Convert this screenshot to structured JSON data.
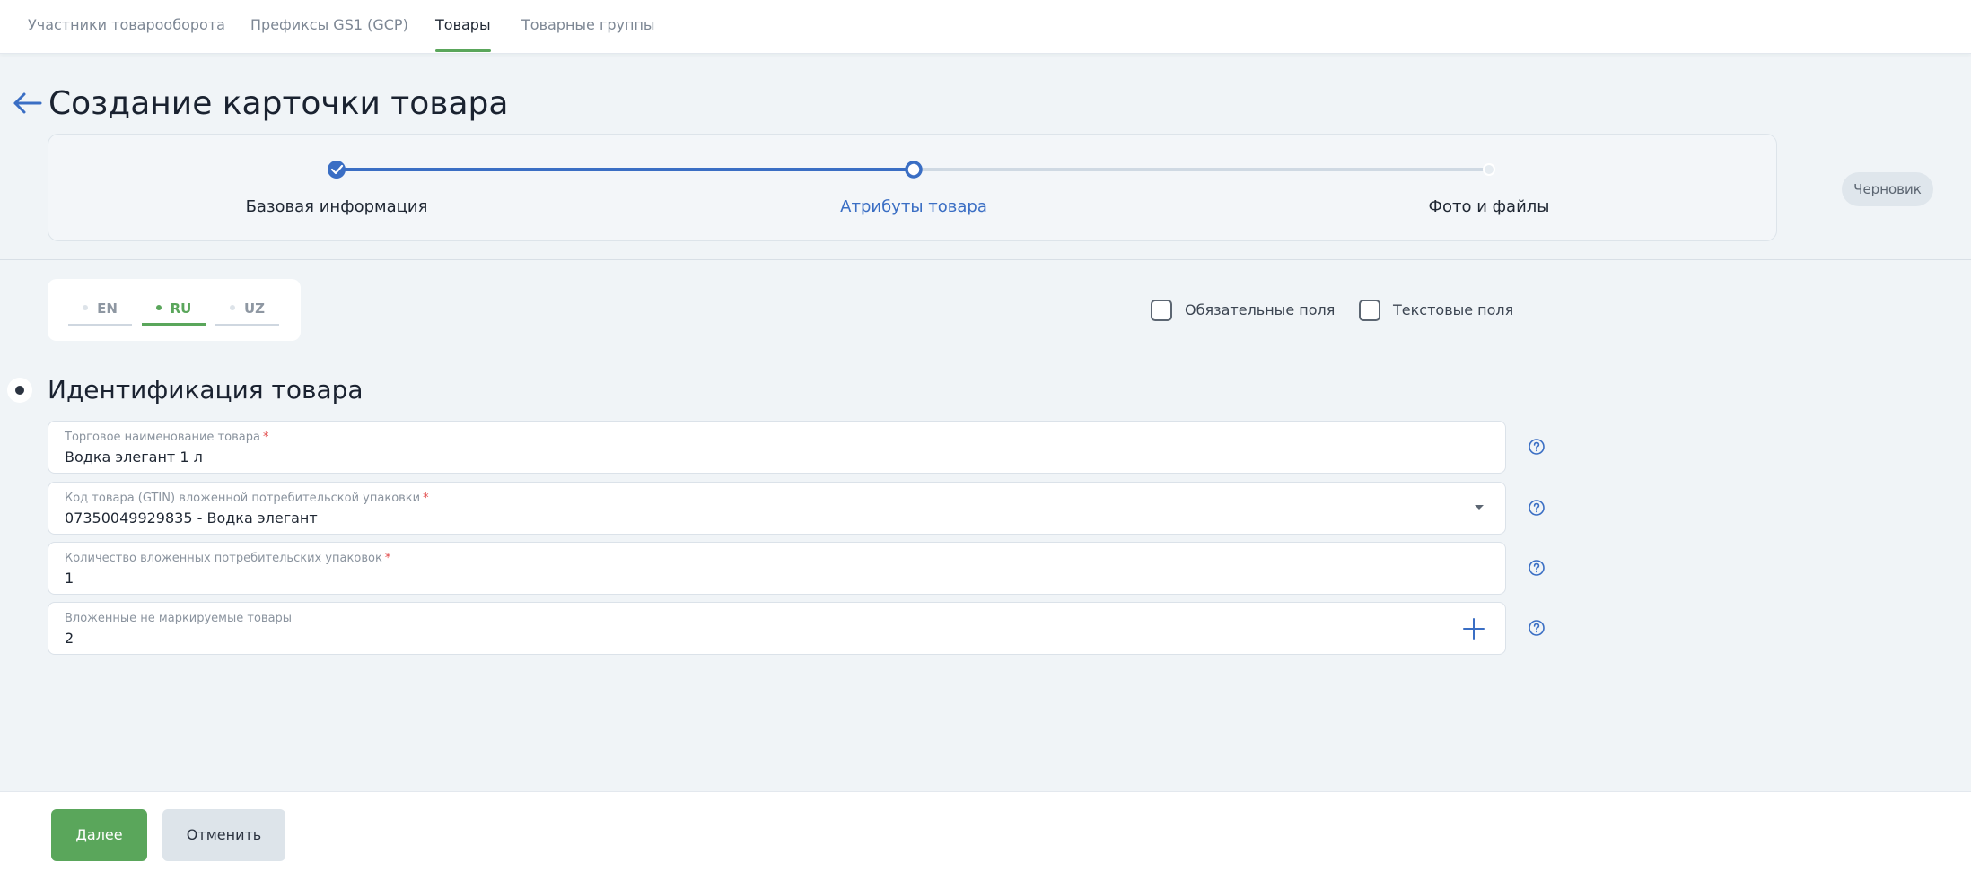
{
  "nav": {
    "tabs": [
      {
        "label": "Участники товарооборота"
      },
      {
        "label": "Префиксы GS1 (GCP)"
      },
      {
        "label": "Товары"
      },
      {
        "label": "Товарные группы"
      }
    ],
    "active_tab": "Товары"
  },
  "page": {
    "title": "Создание карточки товара",
    "status_badge": "Черновик"
  },
  "stepper": {
    "steps": [
      {
        "label": "Базовая информация",
        "state": "done"
      },
      {
        "label": "Атрибуты товара",
        "state": "current"
      },
      {
        "label": "Фото и файлы",
        "state": "pending"
      }
    ]
  },
  "languages": {
    "items": [
      "EN",
      "RU",
      "UZ"
    ],
    "active": "RU"
  },
  "filters": {
    "required_label": "Обязательные поля",
    "required_checked": false,
    "text_label": "Текстовые поля",
    "text_checked": false
  },
  "section": {
    "title": "Идентификация товара",
    "fields": [
      {
        "label": "Торговое наименование товара",
        "required": "*",
        "value": "Водка элегант 1 л"
      },
      {
        "label": "Код товара (GTIN) вложенной потребительской упаковки",
        "required": "*",
        "value": "07350049929835 - Водка элегант"
      },
      {
        "label": "Количество вложенных потребительских упаковок",
        "required": "*",
        "value": "1"
      },
      {
        "label": "Вложенные не маркируемые товары",
        "required": "",
        "value": "2"
      }
    ]
  },
  "footer": {
    "next_label": "Далее",
    "cancel_label": "Отменить"
  },
  "colors": {
    "accent_green": "#5aa65b",
    "accent_blue": "#3a6ec4",
    "required_red": "#e24b4b"
  }
}
